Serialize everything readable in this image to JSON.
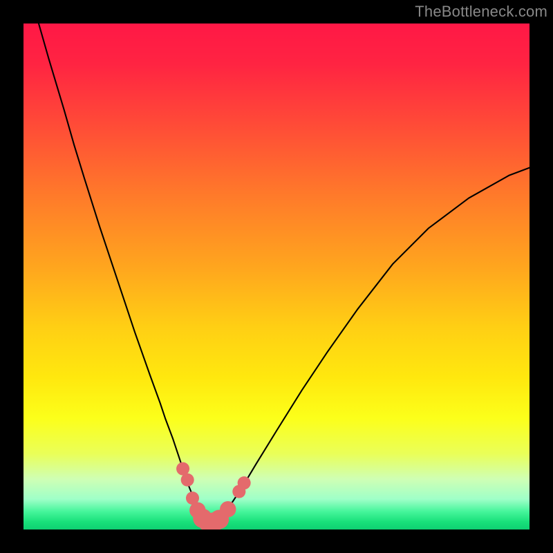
{
  "watermark": "TheBottleneck.com",
  "chart_data": {
    "type": "line",
    "title": "",
    "xlabel": "",
    "ylabel": "",
    "xlim": [
      0,
      100
    ],
    "ylim": [
      0,
      100
    ],
    "curve": {
      "name": "bottleneck-curve",
      "x": [
        3,
        5,
        8,
        10,
        12,
        15,
        18,
        20,
        22,
        25,
        27,
        28,
        29.5,
        30.5,
        31.5,
        32.5,
        33.5,
        34.5,
        35.25,
        36,
        37,
        38,
        39.5,
        41,
        43,
        46,
        50,
        55,
        60,
        66,
        73,
        80,
        88,
        96,
        100
      ],
      "y": [
        100,
        93,
        83,
        76,
        69.5,
        60,
        51,
        45,
        39,
        30.5,
        25,
        22,
        18,
        15,
        12,
        9,
        6.5,
        4,
        2.5,
        1.5,
        1.2,
        1.5,
        2.8,
        5,
        8,
        13,
        19.5,
        27.5,
        35,
        43.5,
        52.5,
        59.5,
        65.5,
        70,
        71.5
      ]
    },
    "markers": {
      "name": "highlighted-points",
      "points": [
        {
          "x": 31.5,
          "y": 12.0,
          "r": 1.3
        },
        {
          "x": 32.4,
          "y": 9.8,
          "r": 1.3
        },
        {
          "x": 33.4,
          "y": 6.2,
          "r": 1.3
        },
        {
          "x": 34.4,
          "y": 3.8,
          "r": 1.6
        },
        {
          "x": 35.4,
          "y": 2.2,
          "r": 1.9
        },
        {
          "x": 36.4,
          "y": 1.5,
          "r": 1.9
        },
        {
          "x": 37.7,
          "y": 1.5,
          "r": 1.9
        },
        {
          "x": 38.7,
          "y": 2.0,
          "r": 1.9
        },
        {
          "x": 40.4,
          "y": 4.0,
          "r": 1.6
        },
        {
          "x": 42.6,
          "y": 7.5,
          "r": 1.3
        },
        {
          "x": 43.6,
          "y": 9.2,
          "r": 1.3
        }
      ]
    },
    "background_gradient": {
      "stops": [
        {
          "offset": 0.0,
          "color": "#ff1846"
        },
        {
          "offset": 0.08,
          "color": "#ff2442"
        },
        {
          "offset": 0.2,
          "color": "#ff4b37"
        },
        {
          "offset": 0.34,
          "color": "#ff7a2a"
        },
        {
          "offset": 0.48,
          "color": "#ffa51e"
        },
        {
          "offset": 0.6,
          "color": "#ffcf14"
        },
        {
          "offset": 0.7,
          "color": "#ffe80e"
        },
        {
          "offset": 0.78,
          "color": "#fcff1a"
        },
        {
          "offset": 0.85,
          "color": "#eaff58"
        },
        {
          "offset": 0.9,
          "color": "#cfffb4"
        },
        {
          "offset": 0.94,
          "color": "#9fffc8"
        },
        {
          "offset": 0.965,
          "color": "#44f59a"
        },
        {
          "offset": 0.985,
          "color": "#18e07a"
        },
        {
          "offset": 1.0,
          "color": "#0fd072"
        }
      ]
    },
    "marker_style": {
      "fill": "#e46a6c",
      "stroke": "none"
    },
    "line_style": {
      "stroke": "#000000",
      "width": 2.1
    }
  }
}
